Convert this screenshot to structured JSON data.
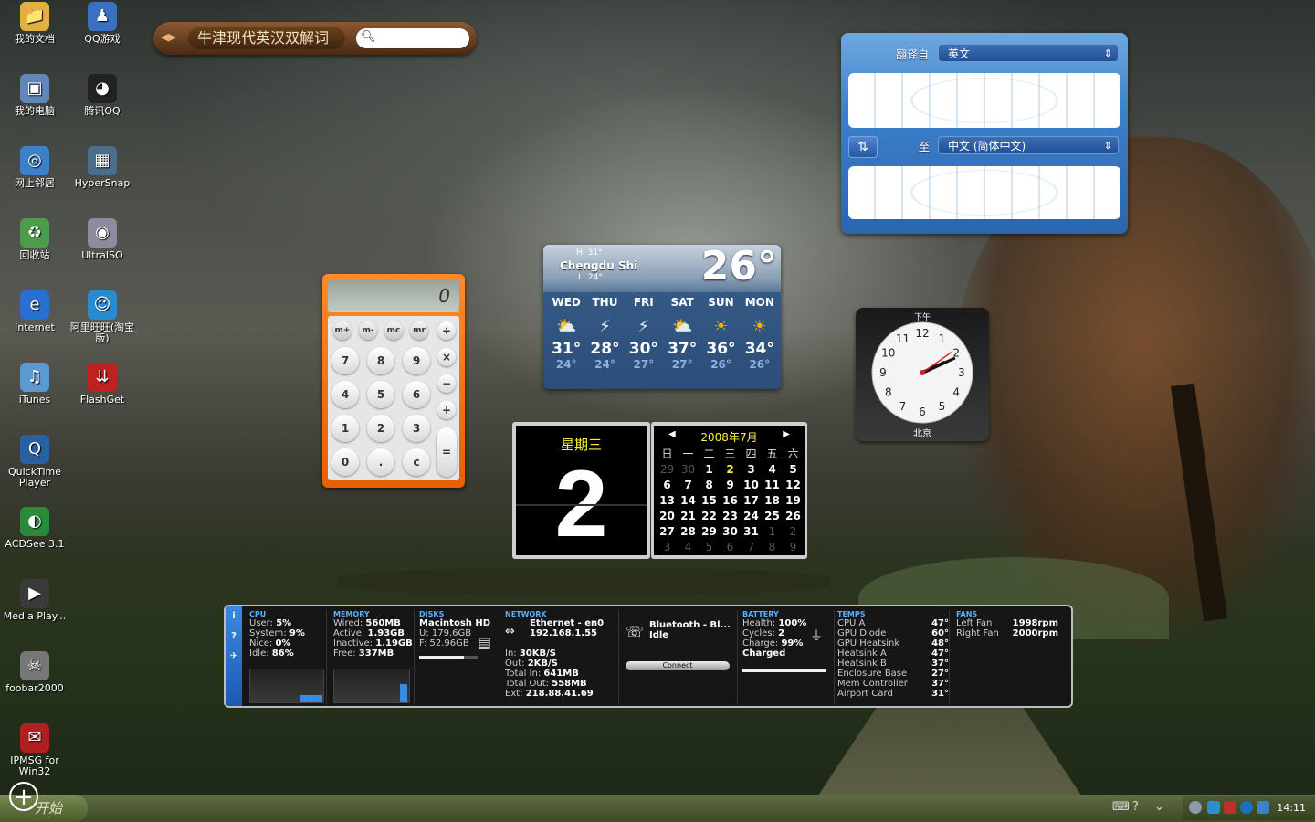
{
  "desktop_icons": [
    {
      "label": "我的文档",
      "icon": "folder-icon"
    },
    {
      "label": "QQ游戏",
      "icon": "qq-game-icon"
    },
    {
      "label": "我的电脑",
      "icon": "computer-icon"
    },
    {
      "label": "腾讯QQ",
      "icon": "qq-icon"
    },
    {
      "label": "网上邻居",
      "icon": "network-icon"
    },
    {
      "label": "HyperSnap",
      "icon": "hypersnap-icon"
    },
    {
      "label": "回收站",
      "icon": "recycle-bin-icon"
    },
    {
      "label": "UltraISO",
      "icon": "disc-icon"
    },
    {
      "label": "Internet",
      "icon": "ie-icon"
    },
    {
      "label": "阿里旺旺(淘宝版)",
      "icon": "aliwangwang-icon"
    },
    {
      "label": "iTunes",
      "icon": "itunes-icon"
    },
    {
      "label": "FlashGet",
      "icon": "flashget-icon"
    },
    {
      "label": "QuickTime Player",
      "icon": "quicktime-icon"
    },
    {
      "label": "ACDSee 3.1",
      "icon": "acdsee-icon"
    },
    {
      "label": "Media Play...",
      "icon": "media-player-icon"
    },
    {
      "label": "foobar2000",
      "icon": "foobar-icon"
    },
    {
      "label": "IPMSG for Win32",
      "icon": "ipmsg-icon"
    }
  ],
  "dictionary": {
    "title": "牛津现代英汉双解词",
    "search_placeholder": ""
  },
  "translation": {
    "from_label": "翻译自",
    "from_value": "英文",
    "to_label": "至",
    "to_value": "中文 (简体中文)",
    "swap_icon": "swap-icon"
  },
  "calculator": {
    "display": "0",
    "memory_keys": [
      "m+",
      "m-",
      "mc",
      "mr"
    ],
    "ops": [
      "÷",
      "×",
      "−",
      "+",
      "="
    ],
    "rows": [
      [
        "7",
        "8",
        "9"
      ],
      [
        "4",
        "5",
        "6"
      ],
      [
        "1",
        "2",
        "3"
      ],
      [
        "0",
        ".",
        "c"
      ]
    ]
  },
  "weather": {
    "city": "Chengdu Shi",
    "high": "H: 31°",
    "low": "L: 24°",
    "current": "26°",
    "days": [
      {
        "name": "WED",
        "icon": "partly-sunny-icon",
        "hi": "31°",
        "lo": "24°"
      },
      {
        "name": "THU",
        "icon": "thunderstorm-icon",
        "hi": "28°",
        "lo": "24°"
      },
      {
        "name": "FRI",
        "icon": "thunderstorm-icon",
        "hi": "30°",
        "lo": "27°"
      },
      {
        "name": "SAT",
        "icon": "partly-sunny-icon",
        "hi": "37°",
        "lo": "27°"
      },
      {
        "name": "SUN",
        "icon": "sunny-icon",
        "hi": "36°",
        "lo": "26°"
      },
      {
        "name": "MON",
        "icon": "sunny-icon",
        "hi": "34°",
        "lo": "26°"
      }
    ]
  },
  "clock": {
    "ampm": "下午",
    "city": "北京",
    "hour": 2,
    "minute": 11,
    "numbers": [
      "12",
      "1",
      "2",
      "3",
      "4",
      "5",
      "6",
      "7",
      "8",
      "9",
      "10",
      "11"
    ]
  },
  "flip_date": {
    "weekday": "星期三",
    "day": "2"
  },
  "calendar": {
    "title": "2008年7月",
    "headers": [
      "日",
      "一",
      "二",
      "三",
      "四",
      "五",
      "六"
    ],
    "weeks": [
      [
        "29",
        "30",
        "1",
        "2",
        "3",
        "4",
        "5"
      ],
      [
        "6",
        "7",
        "8",
        "9",
        "10",
        "11",
        "12"
      ],
      [
        "13",
        "14",
        "15",
        "16",
        "17",
        "18",
        "19"
      ],
      [
        "20",
        "21",
        "22",
        "23",
        "24",
        "25",
        "26"
      ],
      [
        "27",
        "28",
        "29",
        "30",
        "31",
        "1",
        "2"
      ],
      [
        "3",
        "4",
        "5",
        "6",
        "7",
        "8",
        "9"
      ]
    ],
    "today": "2"
  },
  "istat": {
    "side": [
      "i",
      "?",
      "✈"
    ],
    "cpu": {
      "title": "CPU",
      "user": "User:",
      "user_v": "5%",
      "system": "System:",
      "system_v": "9%",
      "nice": "Nice:",
      "nice_v": "0%",
      "idle": "Idle:",
      "idle_v": "86%"
    },
    "memory": {
      "title": "MEMORY",
      "wired": "Wired:",
      "wired_v": "560MB",
      "active": "Active:",
      "active_v": "1.93GB",
      "inactive": "Inactive:",
      "inactive_v": "1.19GB",
      "free": "Free:",
      "free_v": "337MB"
    },
    "disks": {
      "title": "DISKS",
      "name": "Macintosh HD",
      "used": "U: 179.6GB",
      "free": "F: 52.96GB",
      "fill": 0.77
    },
    "network": {
      "title": "NETWORK",
      "iface": "Ethernet - en0",
      "ip": "192.168.1.55",
      "in": "In:",
      "in_v": "30KB/S",
      "out": "Out:",
      "out_v": "2KB/S",
      "total_in": "Total In:",
      "total_in_v": "641MB",
      "total_out": "Total Out:",
      "total_out_v": "558MB",
      "ext": "Ext:",
      "ext_v": "218.88.41.69"
    },
    "bluetooth": {
      "name": "Bluetooth - Bl...",
      "status": "Idle",
      "button": "Connect"
    },
    "battery": {
      "title": "BATTERY",
      "health": "Health:",
      "health_v": "100%",
      "cycles": "Cycles:",
      "cycles_v": "2",
      "charge": "Charge:",
      "charge_v": "99%",
      "status": "Charged",
      "fill": 0.99
    },
    "temps": {
      "title": "TEMPS",
      "rows": [
        [
          "CPU A",
          "47°"
        ],
        [
          "GPU Diode",
          "60°"
        ],
        [
          "GPU Heatsink",
          "48°"
        ],
        [
          "Heatsink A",
          "47°"
        ],
        [
          "Heatsink B",
          "37°"
        ],
        [
          "Enclosure Base",
          "27°"
        ],
        [
          "Mem Controller",
          "37°"
        ],
        [
          "Airport Card",
          "31°"
        ]
      ]
    },
    "fans": {
      "title": "FANS",
      "rows": [
        [
          "Left Fan",
          "1998rpm"
        ],
        [
          "Right Fan",
          "2000rpm"
        ]
      ]
    }
  },
  "taskbar": {
    "start": "开始",
    "time": "14:11"
  }
}
